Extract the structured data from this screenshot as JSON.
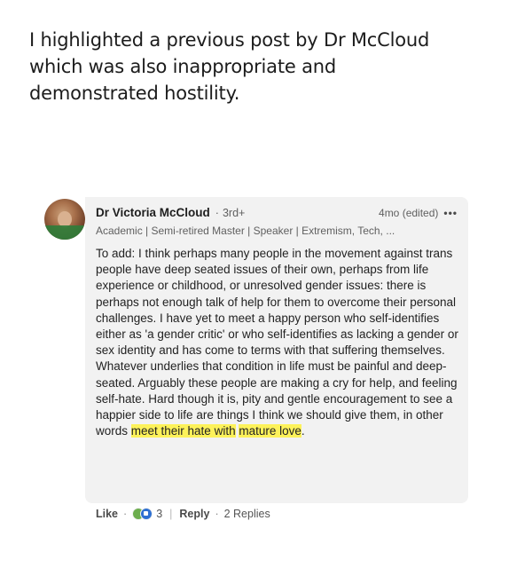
{
  "caption": {
    "line1": "I highlighted a previous post by Dr McCloud",
    "line2": "which was also inappropriate and",
    "line3": "demonstrated hostility."
  },
  "comment": {
    "author": "Dr Victoria McCloud",
    "degree": "3rd+",
    "time": "4mo (edited)",
    "more_icon": "more-horizontal-icon",
    "headline": "Academic | Semi-retired Master | Speaker | Extremism, Tech, ...",
    "body_main": "To add: I think perhaps many people in the movement against trans people have deep seated issues of their own, perhaps from life experience or childhood, or unresolved gender issues: there is perhaps not enough talk of help for them to overcome their personal challenges. I have yet to meet a happy person who self-identifies either as 'a gender critic' or who self-identifies as lacking a gender or sex identity and has come to terms with that suffering themselves. Whatever underlies that condition in life must be painful and deep-seated. Arguably these people are making a cry for help, and feeling self-hate. Hard though it is, pity and gentle encouragement to see a happier side to life are things I think we should give them, in other words ",
    "body_highlight_1": "meet their hate with",
    "body_highlight_2": "mature love",
    "body_end": ".",
    "highlight_color": "#fdf25a"
  },
  "actions": {
    "like_label": "Like",
    "reaction_icons": [
      "celebrate-icon",
      "like-icon"
    ],
    "reaction_count": "3",
    "reply_label": "Reply",
    "replies_label": "2 Replies"
  }
}
